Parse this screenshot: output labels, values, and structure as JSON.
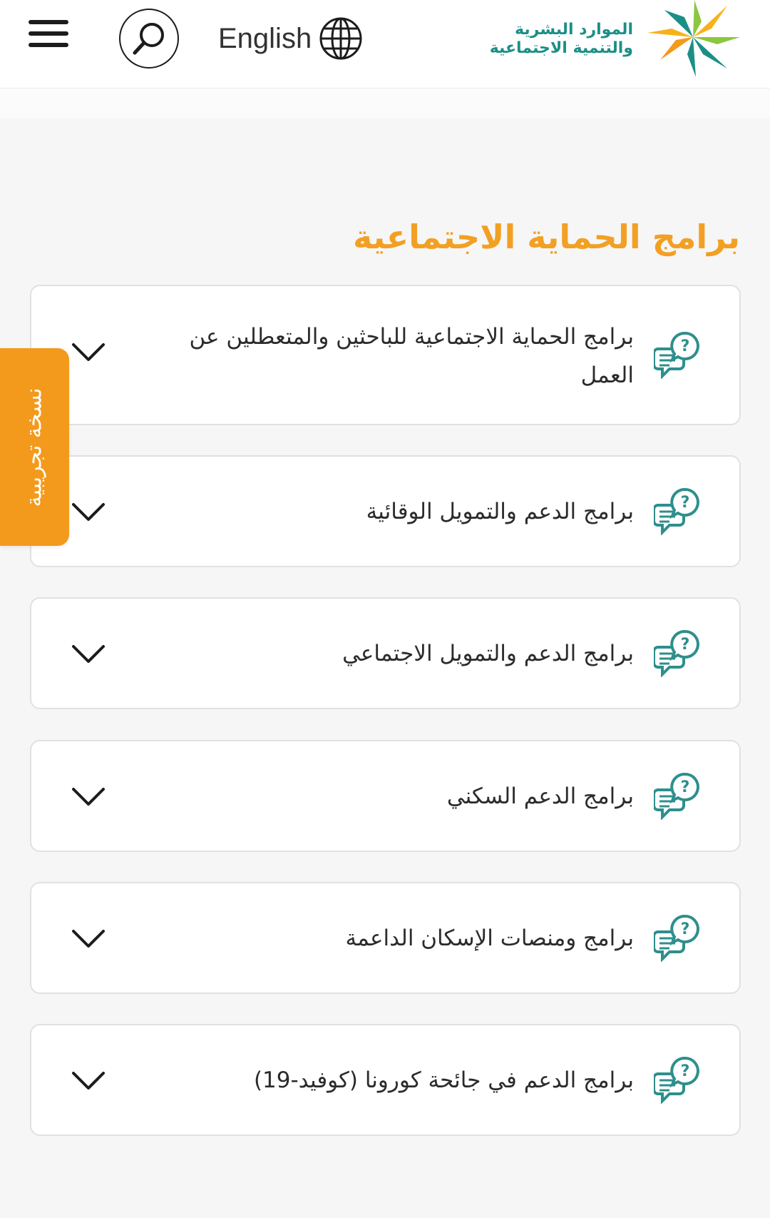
{
  "header": {
    "menu_icon": "hamburger-menu-icon",
    "search_icon": "search-icon",
    "language_label": "English",
    "language_icon": "globe-icon",
    "logo_line1": "الموارد البشرية",
    "logo_line2": "والتنمية الاجتماعية"
  },
  "page": {
    "title": "برامج الحماية الاجتماعية"
  },
  "accordion": [
    {
      "label": "برامج الحماية الاجتماعية للباحثين والمتعطلين عن العمل",
      "icon": "faq-chat-icon",
      "toggle_icon": "chevron-down-icon"
    },
    {
      "label": "برامج الدعم والتمويل الوقائية",
      "icon": "faq-chat-icon",
      "toggle_icon": "chevron-down-icon"
    },
    {
      "label": "برامج الدعم والتمويل الاجتماعي",
      "icon": "faq-chat-icon",
      "toggle_icon": "chevron-down-icon"
    },
    {
      "label": "برامج الدعم السكني",
      "icon": "faq-chat-icon",
      "toggle_icon": "chevron-down-icon"
    },
    {
      "label": "برامج ومنصات الإسكان الداعمة",
      "icon": "faq-chat-icon",
      "toggle_icon": "chevron-down-icon"
    },
    {
      "label": "برامج الدعم في جائحة كورونا (كوفيد-19)",
      "icon": "faq-chat-icon",
      "toggle_icon": "chevron-down-icon"
    }
  ],
  "beta_tab": {
    "label": "نسخة تجريبية"
  },
  "colors": {
    "accent_orange": "#f2a024",
    "brand_teal": "#1b8f87",
    "icon_teal": "#2e8f8c"
  }
}
